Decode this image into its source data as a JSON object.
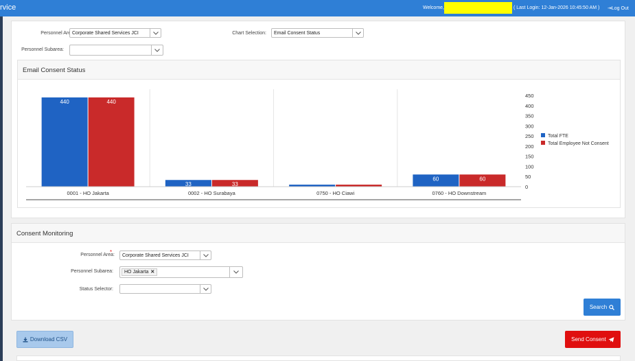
{
  "header": {
    "brand": "rvice",
    "welcome": "Welcome,",
    "last_login": "( Last Login: 12-Jan-2026 10:45:50 AM )",
    "logout": "Log Out"
  },
  "filters": {
    "personnel_area_label": "Personnel Area:",
    "personnel_area_value": "Corporate Shared Services JCI",
    "chart_selection_label": "Chart Selection:",
    "chart_selection_value": "Email Consent Status",
    "personnel_subarea_label": "Personnel Subarea:",
    "personnel_subarea_value": ""
  },
  "chart_panel": {
    "title": "Email Consent Status"
  },
  "chart_data": {
    "type": "bar",
    "categories": [
      "0001 - HO Jakarta",
      "0002 - HO Surabaya",
      "0750 - HO Ciawi",
      "0760 - HO Downstream"
    ],
    "series": [
      {
        "name": "Total FTE",
        "values": [
          440,
          33,
          10,
          60
        ],
        "labels": [
          "440",
          "33",
          "",
          "60"
        ],
        "color": "#1f63c3"
      },
      {
        "name": "Total Employee Not Consent",
        "values": [
          440,
          33,
          10,
          60
        ],
        "labels": [
          "440",
          "33",
          "",
          "60"
        ],
        "color": "#c92a2a"
      }
    ],
    "yticks": [
      "0",
      "50",
      "100",
      "150",
      "200",
      "250",
      "300",
      "350",
      "400",
      "450"
    ],
    "ylim": [
      0,
      450
    ],
    "legend_position": "right",
    "grid": true
  },
  "monitoring": {
    "title": "Consent Monitoring",
    "personnel_area_label": "Personnel Area:",
    "required_mark": "*",
    "personnel_area_value": "Corporate Shared Services JCI",
    "personnel_subarea_label": "Personnel Subarea:",
    "subarea_tag": "HO Jakarta",
    "status_selector_label": "Status Selector:",
    "status_selector_value": "",
    "search_label": "Search"
  },
  "actions": {
    "download_csv": "Download CSV",
    "send_consent": "Send Consent"
  },
  "icons": {
    "logout": "logout-icon",
    "search": "search-icon",
    "download": "download-icon",
    "send": "paper-plane-icon",
    "remove": "close-icon",
    "dropdown": "chevron-down-icon"
  }
}
